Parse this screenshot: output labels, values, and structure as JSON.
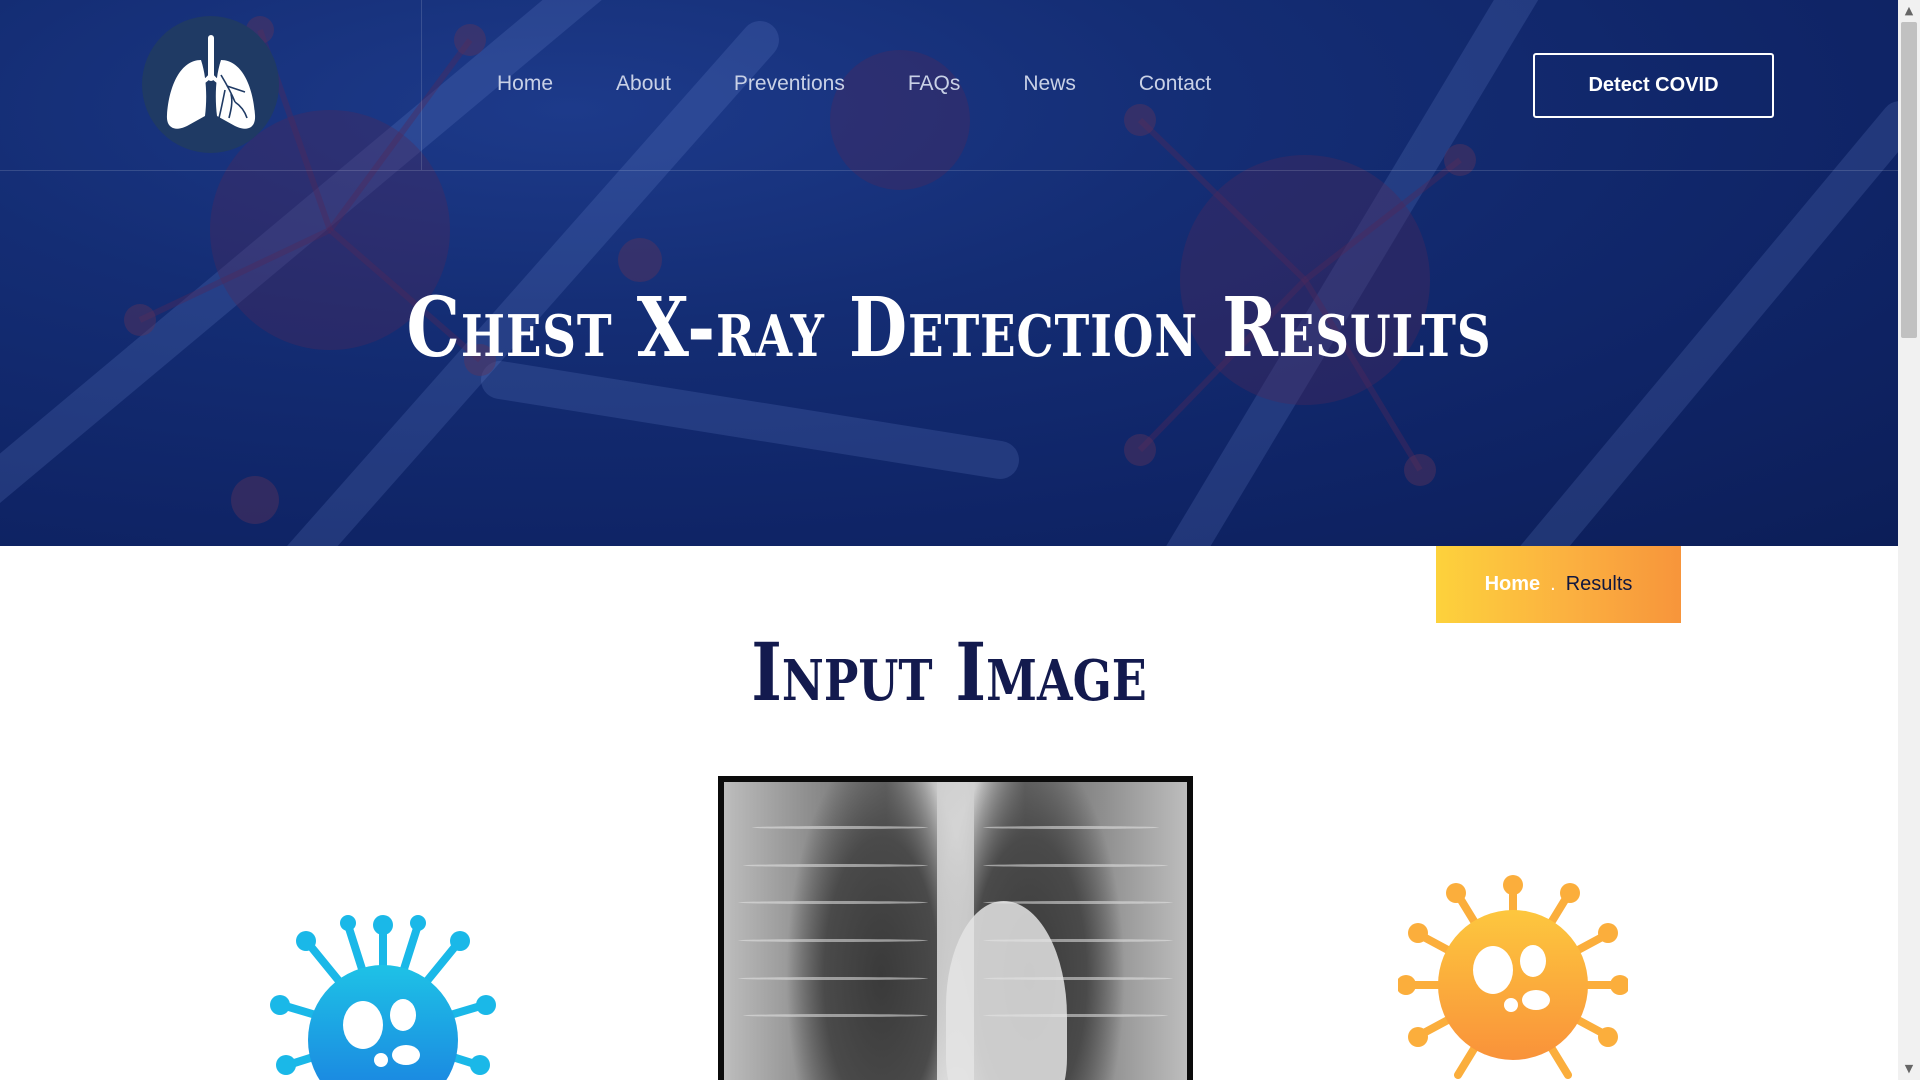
{
  "header": {
    "nav": [
      "Home",
      "About",
      "Preventions",
      "FAQs",
      "News",
      "Contact"
    ],
    "cta_label": "Detect COVID"
  },
  "hero": {
    "title": "Chest X-ray Detection Results"
  },
  "breadcrumb": {
    "home": "Home",
    "separator": ".",
    "current": "Results"
  },
  "section": {
    "title": "Input Image"
  },
  "icons": {
    "logo": "lungs-icon",
    "left_decoration": "virus-icon",
    "right_decoration": "virus-icon"
  },
  "colors": {
    "hero_bg": "#142d74",
    "title_dark": "#131a4e",
    "breadcrumb_start": "#fdd23c",
    "breadcrumb_end": "#f7953b",
    "virus_blue": "#1ab8e8",
    "virus_orange": "#fbae3c"
  },
  "scrollbar": {
    "up_arrow": "▲",
    "down_arrow": "▼"
  }
}
